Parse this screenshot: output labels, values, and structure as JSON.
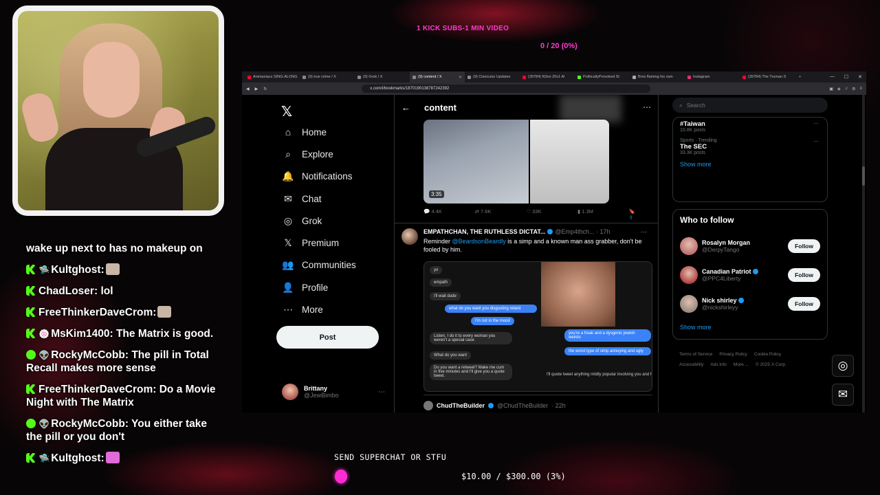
{
  "overlay": {
    "kick_goal": "1 KICK SUBS-1 MIN VIDEO",
    "kick_progress": "0 / 20 (0%)",
    "superchat_label": "SEND SUPERCHAT OR STFU",
    "superchat_progress": "$10.00 / $300.00 (3%)",
    "superchat_fraction": 0.03
  },
  "chat": [
    {
      "badge": "none",
      "user": "",
      "text": "wake up next to has no makeup on",
      "emote": false
    },
    {
      "badge": "kick",
      "user": "Kultghost:",
      "text": "",
      "emote": true,
      "glyph": "🛸"
    },
    {
      "badge": "kick",
      "user": "ChadLoser:",
      "text": "lol",
      "emote": false
    },
    {
      "badge": "kick",
      "user": "FreeThinkerDaveCrom:",
      "text": "",
      "emote": true
    },
    {
      "badge": "kick",
      "user": "MsKim1400:",
      "text": "The Matrix is good.",
      "emote": false,
      "glyph": "🍥"
    },
    {
      "badge": "yt",
      "user": "RockyMcCobb:",
      "text": "The pill in Total Recall makes more sense",
      "emote": false,
      "glyph": "👽"
    },
    {
      "badge": "kick",
      "user": "FreeThinkerDaveCrom:",
      "text": "Do a Movie Night with The Matrix",
      "emote": false
    },
    {
      "badge": "yt",
      "user": "RockyMcCobb:",
      "text": "You either take the pill or you don't",
      "emote": false,
      "glyph": "👽"
    },
    {
      "badge": "kick",
      "user": "Kultghost:",
      "text": "",
      "emote": true,
      "glyph": "🛸",
      "pink": true
    }
  ],
  "browser": {
    "tabs": [
      {
        "label": "Animaniacs SING-ALONG",
        "color": "#ff0033"
      },
      {
        "label": "(9) true crime / X",
        "color": "#888888"
      },
      {
        "label": "(9) Grok / X",
        "color": "#888888"
      },
      {
        "label": "(9) content / X",
        "color": "#888888",
        "active": true
      },
      {
        "label": "(9) Clavicular Updates",
        "color": "#888888"
      },
      {
        "label": "(39784) N3on 20v1 Al",
        "color": "#ff0033"
      },
      {
        "label": "PoliticallyProvoked St",
        "color": "#53fc18"
      },
      {
        "label": "Bros flaming his own",
        "color": "#aaaaaa"
      },
      {
        "label": "Instagram",
        "color": "#e1306c"
      },
      {
        "label": "(39784) The Truman S",
        "color": "#ff0033"
      }
    ],
    "url": "x.com/i/bookmarks/1870190138787242392"
  },
  "x": {
    "nav": [
      {
        "icon": "⌂",
        "label": "Home",
        "name": "home"
      },
      {
        "icon": "⌕",
        "label": "Explore",
        "name": "explore"
      },
      {
        "icon": "🔔",
        "label": "Notifications",
        "name": "notifications"
      },
      {
        "icon": "✉",
        "label": "Chat",
        "name": "chat"
      },
      {
        "icon": "◎",
        "label": "Grok",
        "name": "grok"
      },
      {
        "icon": "𝕏",
        "label": "Premium",
        "name": "premium"
      },
      {
        "icon": "👥",
        "label": "Communities",
        "name": "communities"
      },
      {
        "icon": "👤",
        "label": "Profile",
        "name": "profile"
      },
      {
        "icon": "⋯",
        "label": "More",
        "name": "more"
      }
    ],
    "post_label": "Post",
    "account": {
      "name": "Brittany",
      "handle": "@JewBimbo"
    },
    "header_title": "content",
    "media_duration": "3:35",
    "actions": {
      "replies": "4.4K",
      "reposts": "7.6K",
      "likes": "33K",
      "views": "1.3M"
    },
    "tweet": {
      "name": "EMPATHCHAN, THE RUTHLESS DICTAT...",
      "handle": "@Emp4thch...",
      "time": "· 17h",
      "text_pre": "Reminder ",
      "mention": "@BeardsonBeardly",
      "text_post": " is a simp and a known man ass grabber, don't be fooled by him."
    },
    "dm_bubbles": [
      {
        "text": "yo",
        "kind": "g"
      },
      {
        "text": "empath",
        "kind": "g"
      },
      {
        "text": "I'll wait dude",
        "kind": "g"
      },
      {
        "text": "what do you want you disgusting retard",
        "kind": "b"
      },
      {
        "text": "I'm not in the mood",
        "kind": "b"
      },
      {
        "text": "Listen, I do it to every woman you weren't a special case",
        "kind": "g"
      },
      {
        "text": "What do you want",
        "kind": "g"
      },
      {
        "text": "Do you want a retweet? Make me cum in five minutes and I'll give you a quote tweet.",
        "kind": "g"
      },
      {
        "text": "you're a freak and a dysgenic jewish weirdo",
        "kind": "b"
      },
      {
        "text": "the worst type of simp annoying and ugly",
        "kind": "b"
      },
      {
        "text": "I'll quote tweet anything mildly popular involving you and help you engagement farm off me",
        "kind": "g"
      }
    ],
    "quote": {
      "name": "ChudTheBuilder",
      "handle": "@ChudTheBuilder",
      "time": "· 22h"
    },
    "search_placeholder": "Search",
    "trends": [
      {
        "category": "",
        "name": "#Taiwan",
        "count": "10.8K posts"
      },
      {
        "category": "Sports · Trending",
        "name": "The SEC",
        "count": "33.3K posts"
      }
    ],
    "show_more": "Show more",
    "who_to_follow_title": "Who to follow",
    "follow": [
      {
        "name": "Rosalyn Morgan",
        "handle": "@DerpyTango",
        "verified": false,
        "color": "#c07070"
      },
      {
        "name": "Canadian Patriot",
        "handle": "@PPC4Liberty",
        "verified": true,
        "color": "#b34242"
      },
      {
        "name": "Nick shirley",
        "handle": "@nickshirleyy",
        "verified": true,
        "color": "#9a8a80"
      }
    ],
    "follow_label": "Follow",
    "footer": [
      "Terms of Service",
      "Privacy Policy",
      "Cookie Policy",
      "Accessibility",
      "Ads info",
      "More ...",
      "© 2025 X Corp."
    ]
  }
}
